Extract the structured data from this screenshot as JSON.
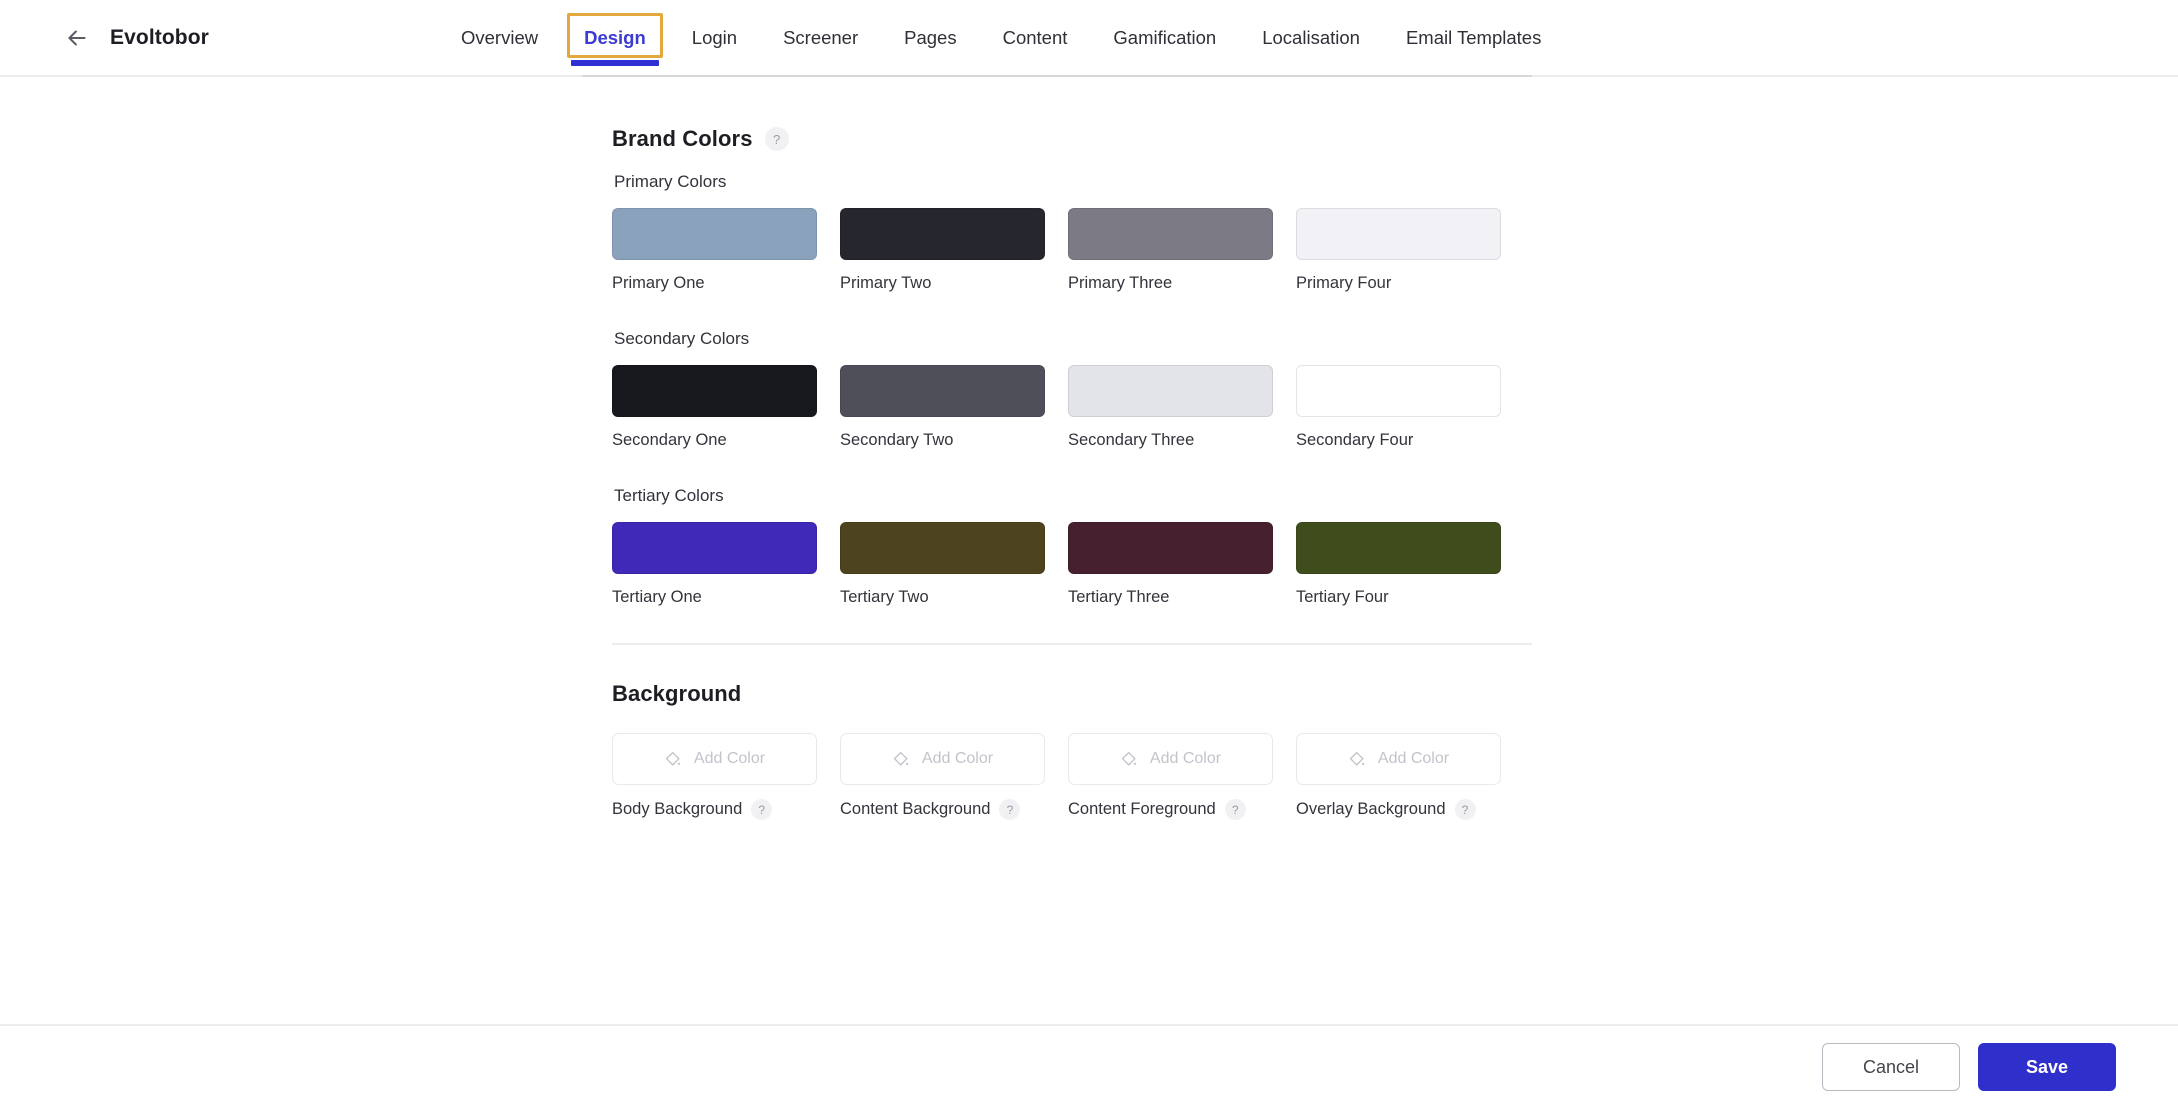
{
  "header": {
    "back_icon": "arrow-left-icon",
    "app_title": "Evoltobor",
    "tabs": [
      {
        "label": "Overview",
        "active": false
      },
      {
        "label": "Design",
        "active": true
      },
      {
        "label": "Login",
        "active": false
      },
      {
        "label": "Screener",
        "active": false
      },
      {
        "label": "Pages",
        "active": false
      },
      {
        "label": "Content",
        "active": false
      },
      {
        "label": "Gamification",
        "active": false
      },
      {
        "label": "Localisation",
        "active": false
      },
      {
        "label": "Email Templates",
        "active": false
      }
    ],
    "active_tab_text_color": "#3b3bd4",
    "active_tab_focus_ring_color": "#e3a83c",
    "active_tab_underline_color": "#2f2fd4"
  },
  "brand_colors": {
    "title": "Brand Colors",
    "help": "?",
    "groups": [
      {
        "label": "Primary Colors",
        "swatches": [
          {
            "label": "Primary One",
            "color": "#8ba2bd"
          },
          {
            "label": "Primary Two",
            "color": "#26272e"
          },
          {
            "label": "Primary Three",
            "color": "#7c7b85"
          },
          {
            "label": "Primary Four",
            "color": "#f2f1f6"
          }
        ]
      },
      {
        "label": "Secondary Colors",
        "swatches": [
          {
            "label": "Secondary One",
            "color": "#16181d"
          },
          {
            "label": "Secondary Two",
            "color": "#4f4f59"
          },
          {
            "label": "Secondary Three",
            "color": "#e3e3ea"
          },
          {
            "label": "Secondary Four",
            "color": "#ffffff"
          }
        ]
      },
      {
        "label": "Tertiary Colors",
        "swatches": [
          {
            "label": "Tertiary One",
            "color": "#4029b8"
          },
          {
            "label": "Tertiary Two",
            "color": "#4d431f"
          },
          {
            "label": "Tertiary Three",
            "color": "#472030"
          },
          {
            "label": "Tertiary Four",
            "color": "#3f4d1c"
          }
        ]
      }
    ]
  },
  "background": {
    "title": "Background",
    "items": [
      {
        "label": "Body Background",
        "button_text": "Add Color",
        "icon": "paint-bucket-icon",
        "help": "?"
      },
      {
        "label": "Content Background",
        "button_text": "Add Color",
        "icon": "paint-bucket-icon",
        "help": "?"
      },
      {
        "label": "Content Foreground",
        "button_text": "Add Color",
        "icon": "paint-bucket-icon",
        "help": "?"
      },
      {
        "label": "Overlay Background",
        "button_text": "Add Color",
        "icon": "paint-bucket-icon",
        "help": "?"
      }
    ]
  },
  "footer": {
    "cancel_label": "Cancel",
    "save_label": "Save",
    "save_color": "#2f2fcc"
  }
}
